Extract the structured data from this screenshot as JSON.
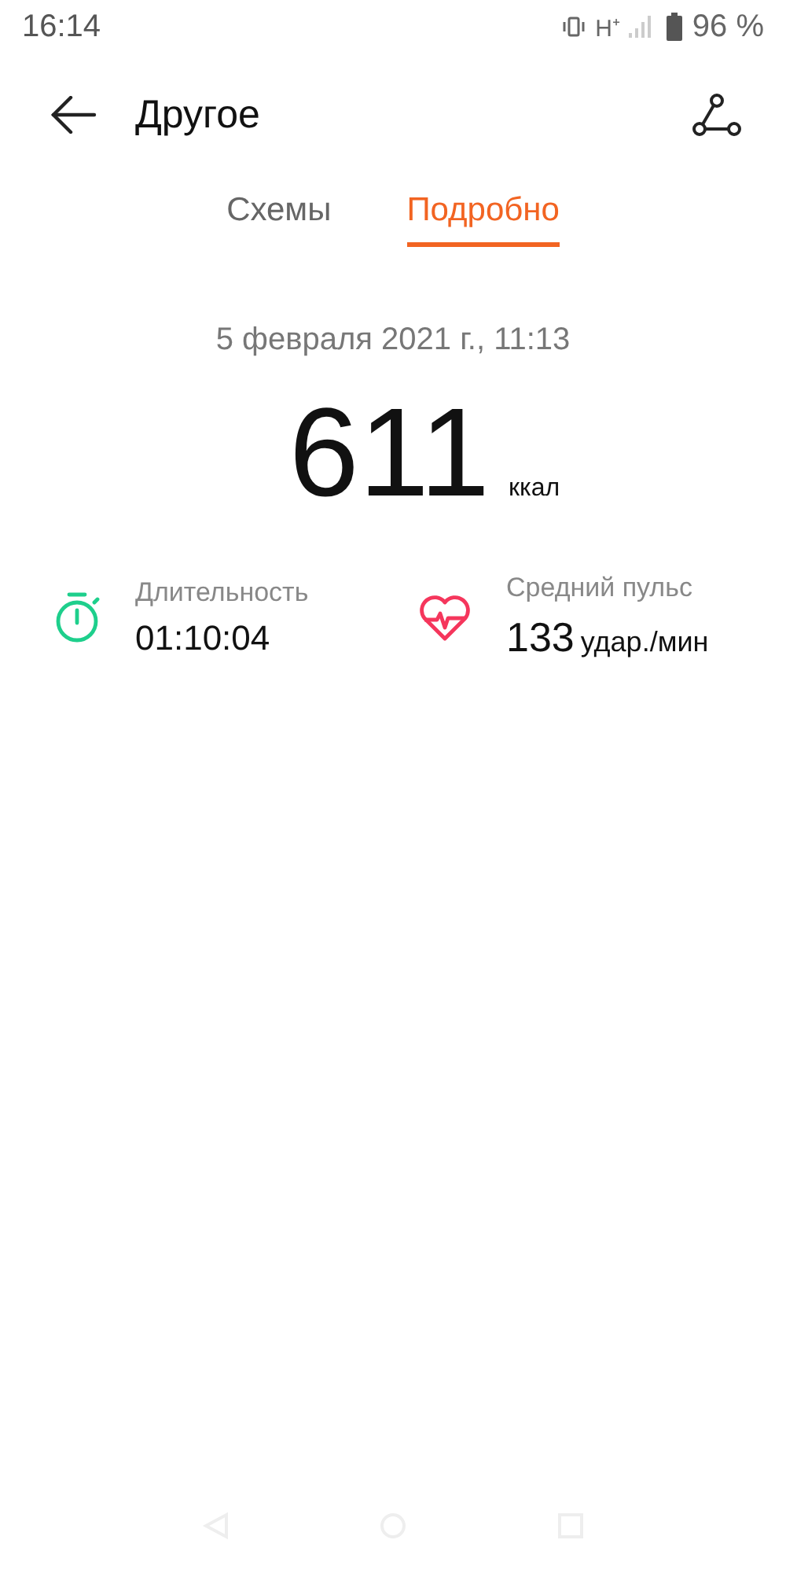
{
  "status_bar": {
    "time": "16:14",
    "network": "H⁺",
    "battery": "96 %"
  },
  "header": {
    "title": "Другое"
  },
  "tabs": [
    {
      "label": "Схемы",
      "selected": false
    },
    {
      "label": "Подробно",
      "selected": true
    }
  ],
  "workout": {
    "date": "5 февраля 2021 г., 11:13",
    "calories": "611",
    "calories_unit": "ккал"
  },
  "stats": [
    {
      "kind": "duration",
      "label": "Длительность",
      "value": "01:10:04",
      "color": "#1ecf8c"
    },
    {
      "kind": "heart",
      "label": "Средний пульс",
      "value": "133",
      "unit": "удар./мин",
      "color": "#f5365c"
    }
  ]
}
